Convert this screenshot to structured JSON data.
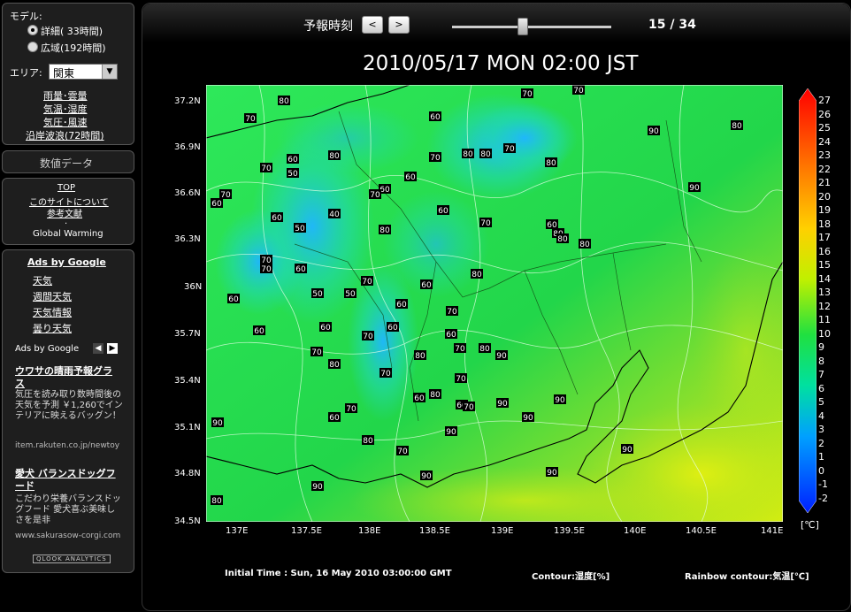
{
  "sidebar": {
    "model_label": "モデル:",
    "model_options": [
      "詳細( 33時間)",
      "広域(192時間)"
    ],
    "area_label": "エリア:",
    "area_value": "関東",
    "var_links": [
      "雨量･雲量",
      "気温･湿度",
      "気圧･風速",
      "沿岸波浪(72時間)"
    ],
    "numeric_label": "数値データ",
    "info_links": [
      "TOP",
      "このサイトについて",
      "参考文献"
    ],
    "info_dot": ".",
    "global_warming": "Global Warming",
    "ads_by_google": "Ads by Google",
    "ad_links": [
      "天気",
      "週間天気",
      "天気情報",
      "曇り天気"
    ],
    "ads_by_google2": "Ads by Google",
    "ads": [
      {
        "title": "ウワサの晴雨予報グラス",
        "body": "気圧を読み取り数時間後の天気を予測 ￥1,260でインテリアに映えるバッグン！",
        "url": "item.rakuten.co.jp/newtoy"
      },
      {
        "title": "愛犬 バランスドッグフード",
        "body": "こだわり栄養バランスドッグフード 愛犬喜ぶ美味しさを是非",
        "url": "www.sakurasow-corgi.com"
      }
    ],
    "analytics": "QLOOK ANALYTICS"
  },
  "header": {
    "forecast_time_label": "予報時刻",
    "prev_label": "<",
    "next_label": ">",
    "step": "15 / 34",
    "slider_fraction": 0.44
  },
  "map": {
    "title": "2010/05/17 MON 02:00 JST",
    "lat_ticks": [
      "37.2N",
      "36.9N",
      "36.6N",
      "36.3N",
      "36N",
      "35.7N",
      "35.4N",
      "35.1N",
      "34.8N",
      "34.5N"
    ],
    "lon_ticks": [
      "137E",
      "137.5E",
      "138E",
      "138.5E",
      "139E",
      "139.5E",
      "140E",
      "140.5E",
      "141E"
    ],
    "contour_labels": [
      "80",
      "70",
      "60",
      "50",
      "40",
      "90"
    ]
  },
  "colorbar": {
    "labels": [
      "27",
      "26",
      "25",
      "24",
      "23",
      "22",
      "21",
      "20",
      "19",
      "18",
      "17",
      "16",
      "15",
      "14",
      "13",
      "12",
      "11",
      "10",
      "9",
      "8",
      "7",
      "6",
      "5",
      "4",
      "3",
      "2",
      "1",
      "0",
      "-1",
      "-2"
    ],
    "unit": "[℃]"
  },
  "footer": {
    "initial_time": "Initial Time : Sun, 16 May 2010 03:00:00 GMT",
    "contour": "Contour:湿度[%]",
    "rainbow": "Rainbow contour:気温[℃]"
  }
}
